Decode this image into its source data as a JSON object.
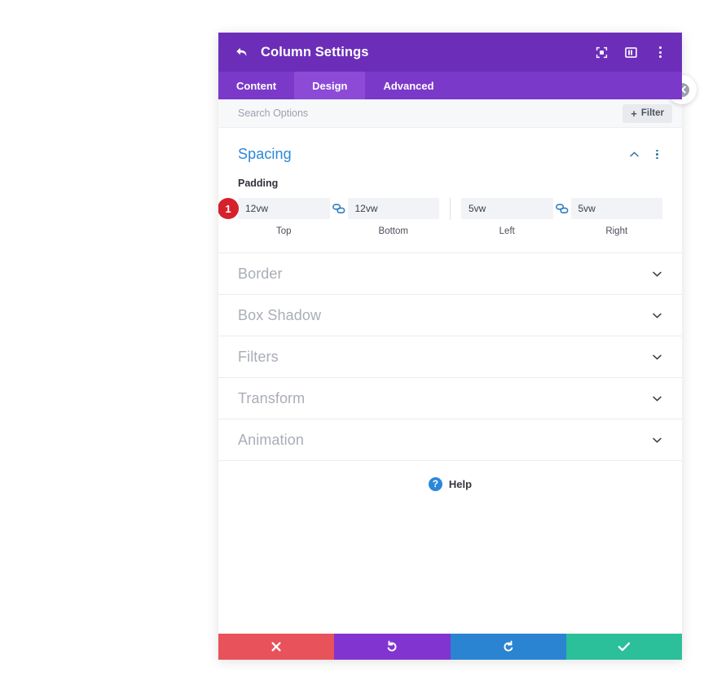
{
  "window": {
    "title": "Column Settings",
    "back_icon": "back-arrow-icon",
    "header_icons": [
      {
        "name": "focus-mode-icon"
      },
      {
        "name": "view-layout-icon"
      },
      {
        "name": "more-options-icon"
      }
    ]
  },
  "tabs": [
    {
      "label": "Content",
      "active": false
    },
    {
      "label": "Design",
      "active": true
    },
    {
      "label": "Advanced",
      "active": false
    }
  ],
  "search": {
    "placeholder": "Search Options",
    "value": "",
    "filter_label": "Filter",
    "filter_plus": "+"
  },
  "spacing": {
    "title": "Spacing",
    "badge": "1",
    "padding_label": "Padding",
    "fields": [
      {
        "value": "12vw",
        "sub": "Top"
      },
      {
        "value": "12vw",
        "sub": "Bottom"
      },
      {
        "value": "5vw",
        "sub": "Left"
      },
      {
        "value": "5vw",
        "sub": "Right"
      }
    ]
  },
  "collapsed_sections": [
    {
      "title": "Border"
    },
    {
      "title": "Box Shadow"
    },
    {
      "title": "Filters"
    },
    {
      "title": "Transform"
    },
    {
      "title": "Animation"
    }
  ],
  "help": {
    "label": "Help",
    "icon_glyph": "?"
  },
  "footer": [
    {
      "name": "cancel-button",
      "icon": "close-icon"
    },
    {
      "name": "undo-button",
      "icon": "undo-icon"
    },
    {
      "name": "redo-button",
      "icon": "redo-icon"
    },
    {
      "name": "save-button",
      "icon": "check-icon"
    }
  ],
  "colors": {
    "titlebar": "#6c2eb9",
    "tabbar": "#7b39c9",
    "tab_active": "#8c4ad6",
    "section_open_title": "#2b87da",
    "section_collapsed_title": "#a9adb6",
    "badge": "#d6202b",
    "link_icon": "#2f7bbf",
    "cancel": "#e8525a",
    "undo": "#8234d0",
    "redo": "#2a84d2",
    "save": "#2bbf9a"
  }
}
